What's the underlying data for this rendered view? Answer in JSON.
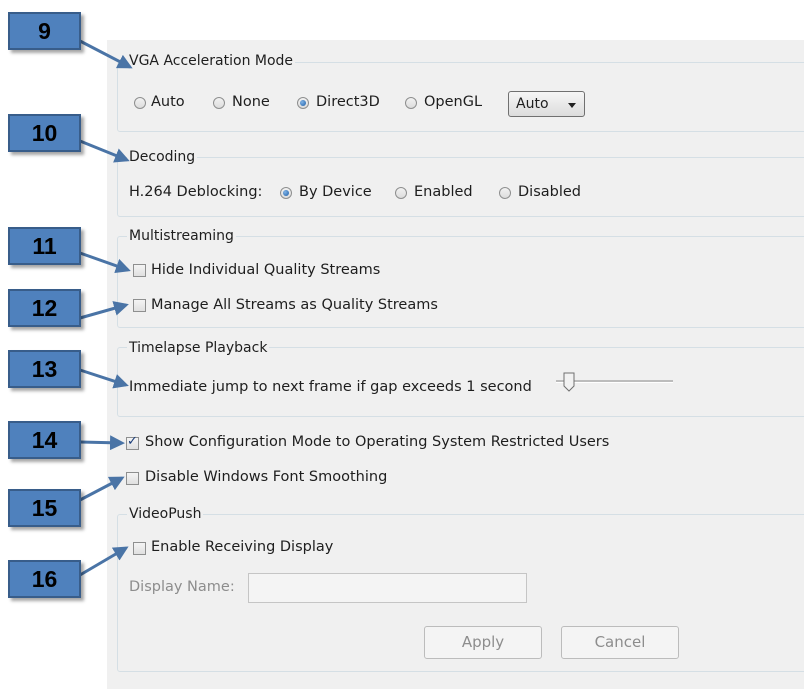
{
  "callouts": [
    "9",
    "10",
    "11",
    "12",
    "13",
    "14",
    "15",
    "16"
  ],
  "vga": {
    "title": "VGA Acceleration Mode",
    "options": [
      "Auto",
      "None",
      "Direct3D",
      "OpenGL"
    ],
    "selected": "Direct3D",
    "dropdown_value": "Auto"
  },
  "decoding": {
    "title": "Decoding",
    "label": "H.264 Deblocking:",
    "options": [
      "By Device",
      "Enabled",
      "Disabled"
    ],
    "selected": "By Device"
  },
  "multistreaming": {
    "title": "Multistreaming",
    "hide_individual": {
      "label": "Hide Individual Quality Streams",
      "checked": false
    },
    "manage_all": {
      "label": "Manage All Streams as Quality Streams",
      "checked": false
    }
  },
  "timelapse": {
    "title": "Timelapse Playback",
    "label": "Immediate jump to next frame if gap exceeds 1 second",
    "slider_value": 0.1
  },
  "show_config": {
    "label": "Show Configuration Mode to Operating System Restricted Users",
    "checked": true
  },
  "disable_font_smoothing": {
    "label": "Disable Windows Font Smoothing",
    "checked": false
  },
  "videopush": {
    "title": "VideoPush",
    "enable_receiving": {
      "label": "Enable Receiving Display",
      "checked": false
    },
    "display_name_label": "Display Name:",
    "display_name_value": "",
    "apply_label": "Apply",
    "cancel_label": "Cancel"
  },
  "colors": {
    "callout_fill": "#4f81bd",
    "callout_border": "#385d8a",
    "panel_bg": "#f0f0f0"
  }
}
